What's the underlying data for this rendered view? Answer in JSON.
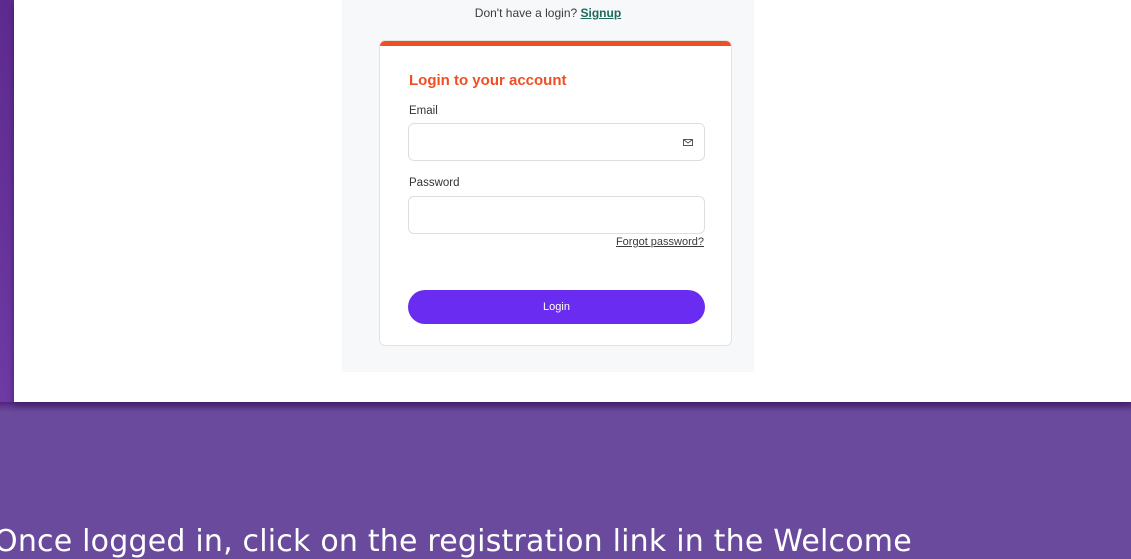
{
  "login_page": {
    "signup_prompt": "Don't have a login?",
    "signup_link": "Signup",
    "card": {
      "title": "Login to your account",
      "email_label": "Email",
      "email_value": "",
      "password_label": "Password",
      "password_value": "",
      "forgot_password_link": "Forgot password?",
      "login_button": "Login",
      "email_icon": "envelope-icon"
    }
  },
  "slide": {
    "caption": "Once logged in, click on the registration link in the Welcome"
  },
  "colors": {
    "slide_background": "#6a4a9c",
    "card_accent": "#f04e23",
    "login_button": "#6a2cf0",
    "signup_link": "#1e6a5c"
  }
}
